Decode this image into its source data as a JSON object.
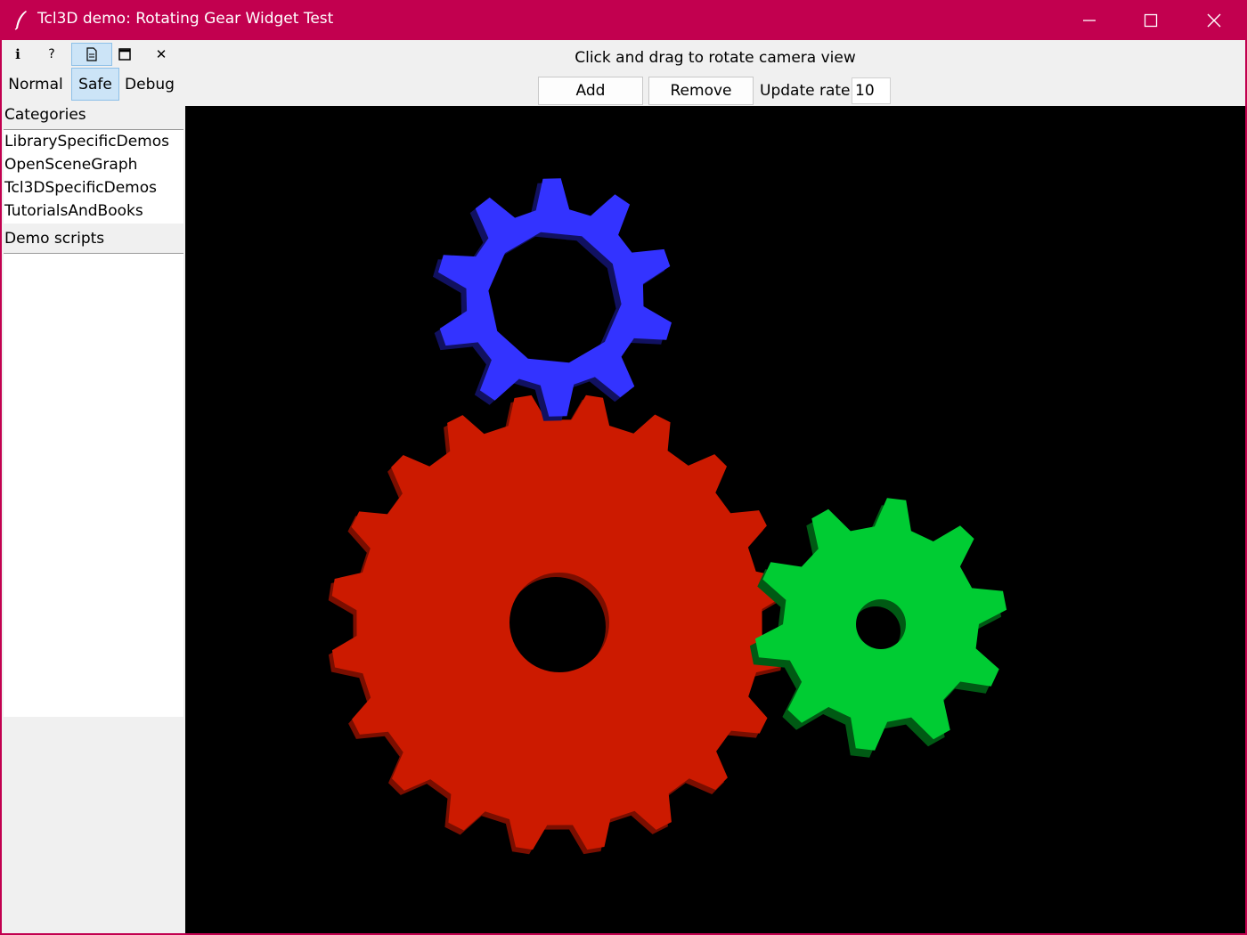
{
  "window": {
    "title": "Tcl3D demo: Rotating Gear Widget Test",
    "titlebar_color": "#c2004f"
  },
  "toolbar": {
    "icons": [
      {
        "name": "info-icon",
        "glyph": "i"
      },
      {
        "name": "help-icon",
        "glyph": "?"
      },
      {
        "name": "document-icon",
        "glyph": ""
      },
      {
        "name": "maximize-viewer-icon",
        "glyph": ""
      },
      {
        "name": "close-viewer-icon",
        "glyph": "✕"
      }
    ],
    "active_icon": "document-icon",
    "modes": [
      "Normal",
      "Safe",
      "Debug"
    ],
    "active_mode": "Safe"
  },
  "sidebar": {
    "categories_label": "Categories",
    "categories": [
      "LibrarySpecificDemos",
      "OpenSceneGraph",
      "Tcl3DSpecificDemos",
      "TutorialsAndBooks"
    ],
    "scripts_label": "Demo scripts",
    "scripts": []
  },
  "main": {
    "hint": "Click and drag to rotate camera view",
    "add_label": "Add",
    "remove_label": "Remove",
    "rate_label": "Update rate:",
    "rate_value": "10"
  },
  "gears": [
    {
      "name": "red-gear",
      "color": "#cc1a00",
      "shadow": "#7a0e00",
      "teeth": 20
    },
    {
      "name": "green-gear",
      "color": "#00cc33",
      "shadow": "#005a14",
      "teeth": 10
    },
    {
      "name": "blue-gear",
      "color": "#3333ff",
      "shadow": "#111160",
      "teeth": 10
    }
  ]
}
